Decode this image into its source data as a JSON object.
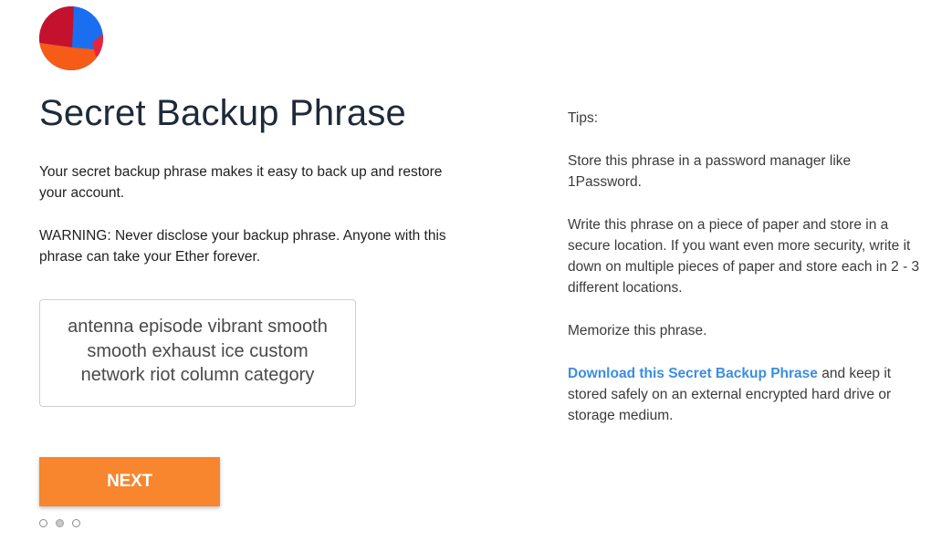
{
  "page": {
    "title": "Secret Backup Phrase",
    "intro": "Your secret backup phrase makes it easy to back up and restore your account.",
    "warning": "WARNING: Never disclose your backup phrase. Anyone with this phrase can take your Ether forever."
  },
  "phrase": {
    "text": "antenna episode vibrant smooth smooth exhaust ice custom network riot column category"
  },
  "actions": {
    "next_label": "NEXT"
  },
  "pagination": {
    "total": 3,
    "active_index": 1
  },
  "tips": {
    "heading": "Tips:",
    "password_manager": "Store this phrase in a password manager like 1Password.",
    "paper": "Write this phrase on a piece of paper and store in a secure location. If you want even more security, write it down on multiple pieces of paper and store each in 2 - 3 different locations.",
    "memorize": "Memorize this phrase.",
    "download_link": "Download this Secret Backup Phrase",
    "download_rest": " and keep it stored safely on an external encrypted hard drive or storage medium."
  },
  "colors": {
    "accent": "#f7862e",
    "link": "#3a8ee0",
    "title": "#1e2a3b"
  },
  "icons": {
    "avatar": "identicon-avatar"
  }
}
